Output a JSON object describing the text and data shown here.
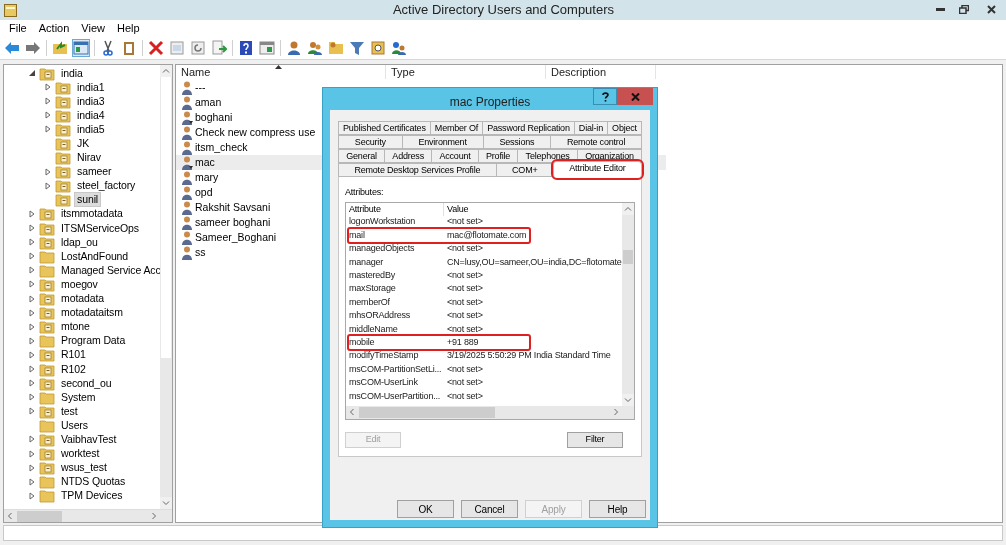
{
  "window": {
    "title": "Active Directory Users and Computers"
  },
  "menu": [
    "File",
    "Action",
    "View",
    "Help"
  ],
  "tree": [
    {
      "label": "india",
      "kind": "ou",
      "expanded": true,
      "selected": false,
      "children": [
        {
          "label": "india1",
          "kind": "ou",
          "expanded": false,
          "selected": false
        },
        {
          "label": "india3",
          "kind": "ou",
          "expanded": false,
          "selected": false
        },
        {
          "label": "india4",
          "kind": "ou",
          "expanded": false,
          "selected": false
        },
        {
          "label": "india5",
          "kind": "ou",
          "expanded": false,
          "selected": false
        },
        {
          "label": "JK",
          "kind": "ou",
          "selected": false
        },
        {
          "label": "Nirav",
          "kind": "ou",
          "selected": false
        },
        {
          "label": "sameer",
          "kind": "ou",
          "expanded": false,
          "selected": false
        },
        {
          "label": "steel_factory",
          "kind": "ou",
          "expanded": false,
          "selected": false
        },
        {
          "label": "sunil",
          "kind": "ou",
          "selected": true
        }
      ]
    },
    {
      "label": "itsmmotadata",
      "kind": "ou",
      "expanded": false,
      "selected": false
    },
    {
      "label": "ITSMServiceOps",
      "kind": "ou",
      "expanded": false,
      "selected": false
    },
    {
      "label": "ldap_ou",
      "kind": "ou",
      "expanded": false,
      "selected": false
    },
    {
      "label": "LostAndFound",
      "kind": "container",
      "expanded": false,
      "selected": false
    },
    {
      "label": "Managed Service Acc",
      "kind": "container",
      "expanded": false,
      "selected": false
    },
    {
      "label": "moegov",
      "kind": "ou",
      "expanded": false,
      "selected": false
    },
    {
      "label": "motadata",
      "kind": "ou",
      "expanded": false,
      "selected": false
    },
    {
      "label": "motadataitsm",
      "kind": "ou",
      "expanded": false,
      "selected": false
    },
    {
      "label": "mtone",
      "kind": "ou",
      "expanded": false,
      "selected": false
    },
    {
      "label": "Program Data",
      "kind": "container",
      "expanded": false,
      "selected": false
    },
    {
      "label": "R101",
      "kind": "ou",
      "expanded": false,
      "selected": false
    },
    {
      "label": "R102",
      "kind": "ou",
      "expanded": false,
      "selected": false
    },
    {
      "label": "second_ou",
      "kind": "ou",
      "expanded": false,
      "selected": false
    },
    {
      "label": "System",
      "kind": "container",
      "expanded": false,
      "selected": false
    },
    {
      "label": "test",
      "kind": "ou",
      "expanded": false,
      "selected": false
    },
    {
      "label": "Users",
      "kind": "container",
      "selected": false
    },
    {
      "label": "VaibhavTest",
      "kind": "ou",
      "expanded": false,
      "selected": false
    },
    {
      "label": "worktest",
      "kind": "ou",
      "expanded": false,
      "selected": false
    },
    {
      "label": "wsus_test",
      "kind": "ou",
      "expanded": false,
      "selected": false
    },
    {
      "label": "NTDS Quotas",
      "kind": "container",
      "expanded": false,
      "selected": false
    },
    {
      "label": "TPM Devices",
      "kind": "container",
      "expanded": false,
      "selected": false
    }
  ],
  "list": {
    "columns": [
      "Name",
      "Type",
      "Description"
    ],
    "rows": [
      {
        "name": "---",
        "kind": "user",
        "selected": false
      },
      {
        "name": "aman",
        "kind": "user",
        "selected": false
      },
      {
        "name": "boghani",
        "kind": "disabled_user",
        "selected": false
      },
      {
        "name": "Check new compress use",
        "kind": "user",
        "selected": false
      },
      {
        "name": "itsm_check",
        "kind": "user",
        "selected": false
      },
      {
        "name": "mac",
        "kind": "disabled_user",
        "selected": true
      },
      {
        "name": "mary",
        "kind": "user",
        "selected": false
      },
      {
        "name": "opd",
        "kind": "user",
        "selected": false
      },
      {
        "name": "Rakshit Savsani",
        "kind": "user",
        "selected": false
      },
      {
        "name": "sameer boghani",
        "kind": "user",
        "selected": false
      },
      {
        "name": "Sameer_Boghani",
        "kind": "user",
        "selected": false
      },
      {
        "name": "ss",
        "kind": "user",
        "selected": false
      }
    ]
  },
  "dialog": {
    "title": "mac Properties",
    "tab_rows": [
      [
        {
          "label": "Published Certificates",
          "selected": false,
          "highlighted": false
        },
        {
          "label": "Member Of",
          "selected": false,
          "highlighted": false
        },
        {
          "label": "Password Replication",
          "selected": false,
          "highlighted": false
        },
        {
          "label": "Dial-in",
          "selected": false,
          "highlighted": false
        },
        {
          "label": "Object",
          "selected": false,
          "highlighted": false
        }
      ],
      [
        {
          "label": "Security",
          "selected": false,
          "highlighted": false
        },
        {
          "label": "Environment",
          "selected": false,
          "highlighted": false
        },
        {
          "label": "Sessions",
          "selected": false,
          "highlighted": false
        },
        {
          "label": "Remote control",
          "selected": false,
          "highlighted": false
        }
      ],
      [
        {
          "label": "General",
          "selected": false,
          "highlighted": false
        },
        {
          "label": "Address",
          "selected": false,
          "highlighted": false
        },
        {
          "label": "Account",
          "selected": false,
          "highlighted": false
        },
        {
          "label": "Profile",
          "selected": false,
          "highlighted": false
        },
        {
          "label": "Telephones",
          "selected": false,
          "highlighted": false
        },
        {
          "label": "Organization",
          "selected": false,
          "highlighted": false
        }
      ],
      [
        {
          "label": "Remote Desktop Services Profile",
          "selected": false,
          "highlighted": false
        },
        {
          "label": "COM+",
          "selected": false,
          "highlighted": false
        },
        {
          "label": "Attribute Editor",
          "selected": true,
          "highlighted": true
        }
      ]
    ],
    "attributes_label": "Attributes:",
    "columns": [
      "Attribute",
      "Value"
    ],
    "rows": [
      {
        "attribute": "logonWorkstation",
        "value": "<not set>",
        "highlighted": false
      },
      {
        "attribute": "mail",
        "value": "mac@flotomate.com",
        "highlighted": true
      },
      {
        "attribute": "managedObjects",
        "value": "<not set>",
        "highlighted": false
      },
      {
        "attribute": "manager",
        "value": "CN=lusy,OU=sameer,OU=india,DC=flotomate",
        "highlighted": false
      },
      {
        "attribute": "masteredBy",
        "value": "<not set>",
        "highlighted": false
      },
      {
        "attribute": "maxStorage",
        "value": "<not set>",
        "highlighted": false
      },
      {
        "attribute": "memberOf",
        "value": "<not set>",
        "highlighted": false
      },
      {
        "attribute": "mhsORAddress",
        "value": "<not set>",
        "highlighted": false
      },
      {
        "attribute": "middleName",
        "value": "<not set>",
        "highlighted": false
      },
      {
        "attribute": "mobile",
        "value": "+91 889",
        "highlighted": true
      },
      {
        "attribute": "modifyTimeStamp",
        "value": "3/19/2025 5:50:29 PM India Standard Time",
        "highlighted": false
      },
      {
        "attribute": "msCOM-PartitionSetLi...",
        "value": "<not set>",
        "highlighted": false
      },
      {
        "attribute": "msCOM-UserLink",
        "value": "<not set>",
        "highlighted": false
      },
      {
        "attribute": "msCOM-UserPartition...",
        "value": "<not set>",
        "highlighted": false
      }
    ],
    "edit_button": {
      "label": "Edit",
      "disabled": true
    },
    "filter_button": {
      "label": "Filter",
      "disabled": false
    },
    "buttons": [
      {
        "label": "OK",
        "disabled": false
      },
      {
        "label": "Cancel",
        "disabled": false
      },
      {
        "label": "Apply",
        "disabled": true
      },
      {
        "label": "Help",
        "disabled": false
      }
    ]
  }
}
